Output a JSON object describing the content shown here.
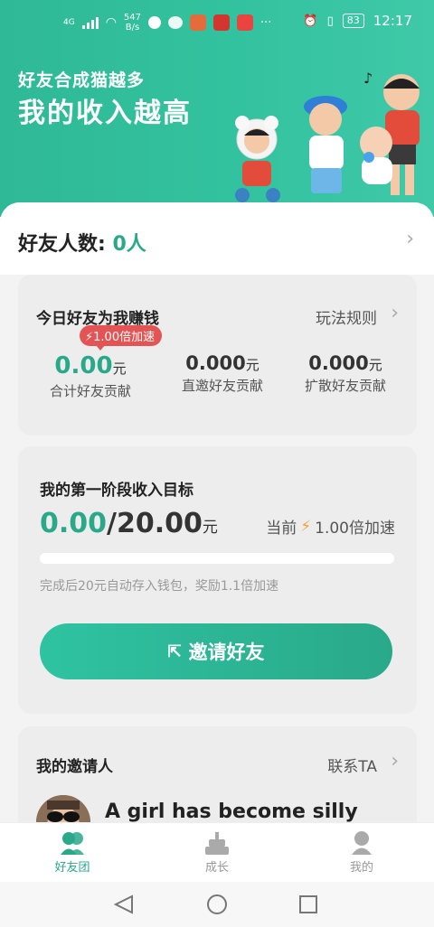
{
  "status_bar": {
    "network": "4G",
    "speed": "547",
    "speed_unit": "B/s",
    "battery": "83",
    "time": "12:17"
  },
  "hero": {
    "subtitle": "好友合成猫越多",
    "title": "我的收入越高"
  },
  "friends": {
    "label": "好友人数:",
    "count": "0人"
  },
  "today": {
    "title": "今日好友为我赚钱",
    "rules_link": "玩法规则",
    "speed_badge": "1.00倍加速",
    "stats": [
      {
        "value": "0.00",
        "unit": "元",
        "label": "合计好友贡献"
      },
      {
        "value": "0.000",
        "unit": "元",
        "label": "直邀好友贡献"
      },
      {
        "value": "0.000",
        "unit": "元",
        "label": "扩散好友贡献"
      }
    ]
  },
  "goal": {
    "title": "我的第一阶段收入目标",
    "current": "0.00",
    "separator": "/",
    "target": "20.00",
    "unit": "元",
    "speed_prefix": "当前",
    "speed_value": "1.00倍加速",
    "progress": 0,
    "note": "完成后20元自动存入钱包，奖励1.1倍加速",
    "invite_button": "邀请好友"
  },
  "inviter": {
    "title": "我的邀请人",
    "contact_link": "联系TA",
    "name": "A girl has become silly"
  },
  "bottom_nav": {
    "items": [
      {
        "label": "好友团",
        "icon": "friends-icon",
        "active": true
      },
      {
        "label": "成长",
        "icon": "growth-icon",
        "active": false
      },
      {
        "label": "我的",
        "icon": "profile-icon",
        "active": false
      }
    ]
  },
  "colors": {
    "accent": "#2aa88a",
    "badge_red": "#e45454",
    "lightning": "#f2a33a"
  }
}
